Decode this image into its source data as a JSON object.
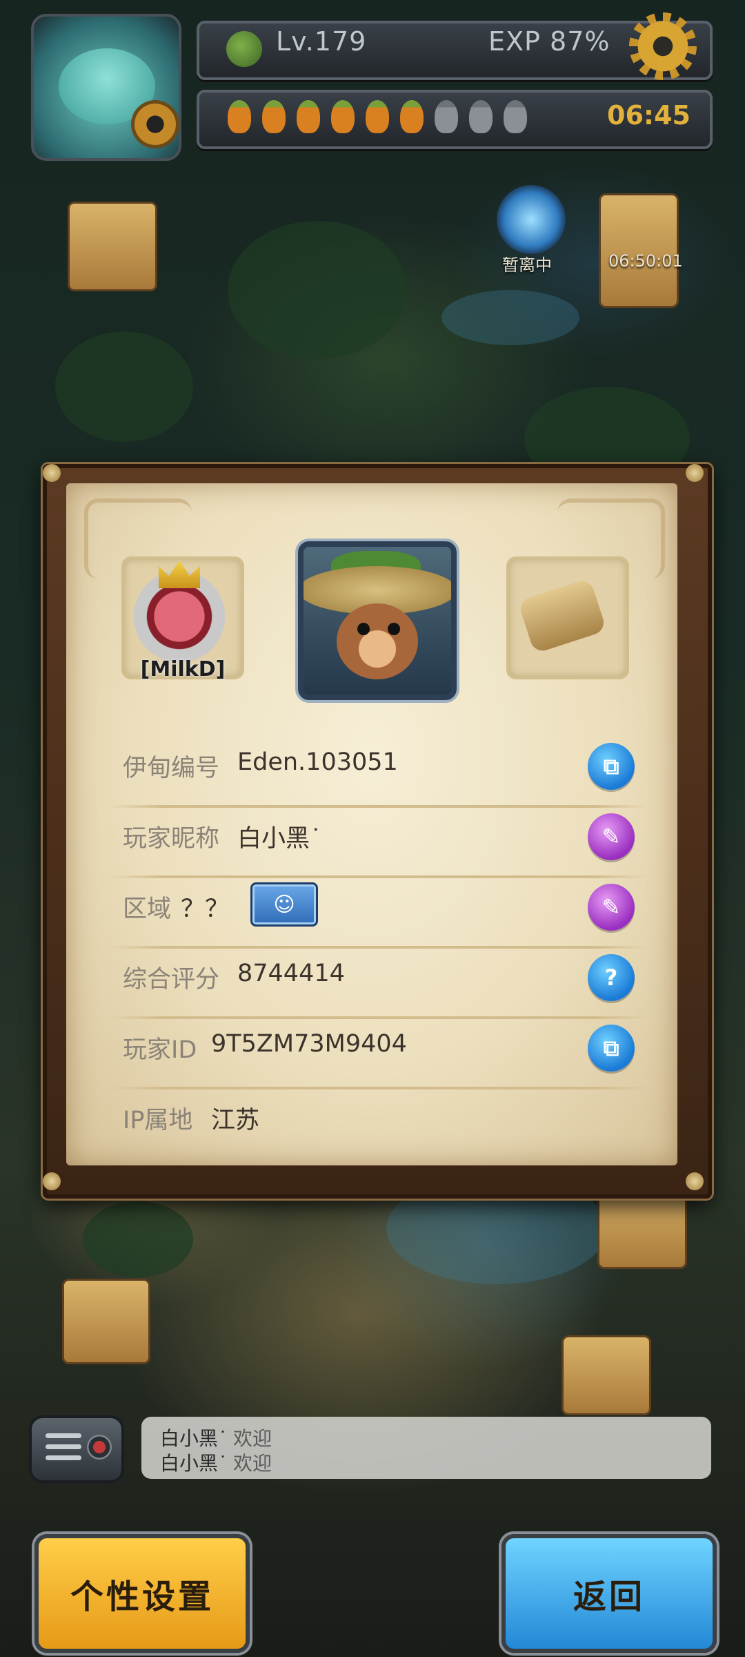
{
  "hud": {
    "level": "Lv.179",
    "exp": "EXP  87%",
    "stamina_total": 9,
    "stamina_filled": 6,
    "timer": "06:45"
  },
  "map": {
    "portal_label": "暂离中",
    "chest_timer": "06:50:01"
  },
  "profile": {
    "guild_tag": "[MilkD]",
    "rows": [
      {
        "label": "伊甸编号",
        "value": "Eden.103051",
        "action_icon": "copy-icon"
      },
      {
        "label": "玩家昵称",
        "value": "白小黑˙",
        "action_icon": "edit-icon"
      },
      {
        "label": "区域",
        "value": "？？",
        "action_icon": "edit-icon"
      },
      {
        "label": "综合评分",
        "value": "8744414",
        "action_icon": "help-icon"
      },
      {
        "label": "玩家ID",
        "value": "9T5ZM73M9404",
        "action_icon": "copy-icon"
      },
      {
        "label": "IP属地",
        "value": "江苏"
      }
    ]
  },
  "chat": {
    "messages": [
      {
        "name": "白小黑˙",
        "text": "欢迎"
      },
      {
        "name": "白小黑˙",
        "text": "欢迎"
      }
    ]
  },
  "buttons": {
    "customize": "个性设置",
    "back": "返回"
  },
  "colors": {
    "gold_button": "#f2b22a",
    "blue_button": "#3aa6ea",
    "wax_blue": "#1a7ad6",
    "wax_purple": "#9a2ec0",
    "timer": "#e2b23c"
  }
}
